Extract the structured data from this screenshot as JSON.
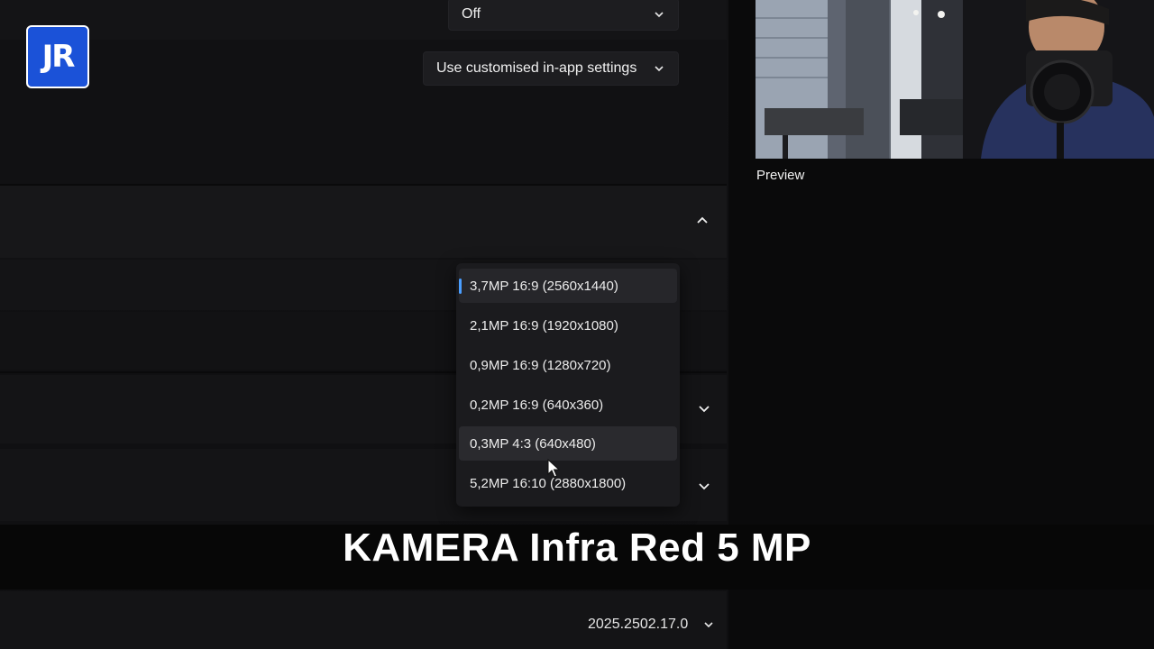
{
  "settings": {
    "top_combo_value": "Off",
    "in_app_combo_value": "Use customised in-app settings",
    "version_value": "2025.2502.17.0"
  },
  "resolution_menu": {
    "options": [
      {
        "label": "3,7MP 16:9 (2560x1440)",
        "state": "selected"
      },
      {
        "label": "2,1MP 16:9 (1920x1080)",
        "state": "normal"
      },
      {
        "label": "0,9MP 16:9 (1280x720)",
        "state": "normal"
      },
      {
        "label": "0,2MP 16:9 (640x360)",
        "state": "normal"
      },
      {
        "label": "0,3MP 4:3 (640x480)",
        "state": "hover"
      },
      {
        "label": "5,2MP 16:10 (2880x1800)",
        "state": "normal"
      }
    ]
  },
  "preview": {
    "label": "Preview"
  },
  "overlay": {
    "brand": "JR",
    "caption": "KAMERA Infra Red 5 MP"
  },
  "colors": {
    "accent": "#4a9eff",
    "brand_blue": "#1b52d8"
  }
}
